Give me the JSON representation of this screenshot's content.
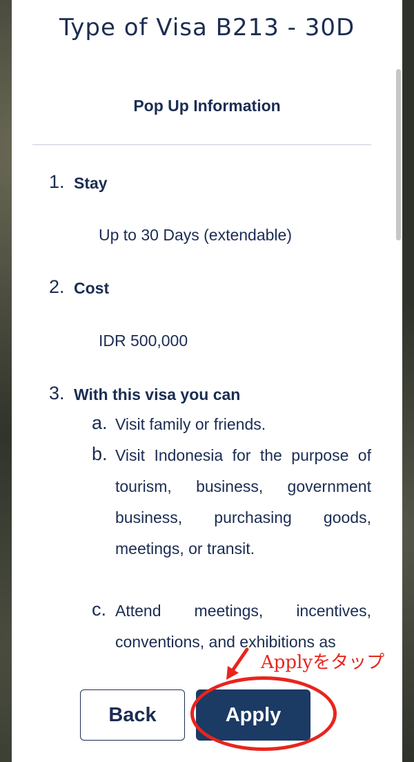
{
  "modal": {
    "title": "Type of Visa B213 - 30D",
    "subtitle": "Pop Up Information"
  },
  "items": [
    {
      "number": "1.",
      "heading": "Stay",
      "value": "Up to 30 Days (extendable)"
    },
    {
      "number": "2.",
      "heading": "Cost",
      "value": "IDR 500,000"
    },
    {
      "number": "3.",
      "heading": "With this visa you can"
    }
  ],
  "sub_items": [
    {
      "letter": "a.",
      "text": "Visit family or friends."
    },
    {
      "letter": "b.",
      "text": "Visit Indonesia for the purpose of tourism, business, government business, purchasing goods, meetings, or transit."
    },
    {
      "letter": "c.",
      "text": "Attend meetings, incentives, conventions, and exhibitions as"
    }
  ],
  "buttons": {
    "back": "Back",
    "apply": "Apply"
  },
  "annotation": {
    "text": "Applyをタップ",
    "color": "#e8251d"
  },
  "colors": {
    "text": "#1b2d52",
    "primary_button": "#1b3a64",
    "divider": "#c8ccda"
  }
}
